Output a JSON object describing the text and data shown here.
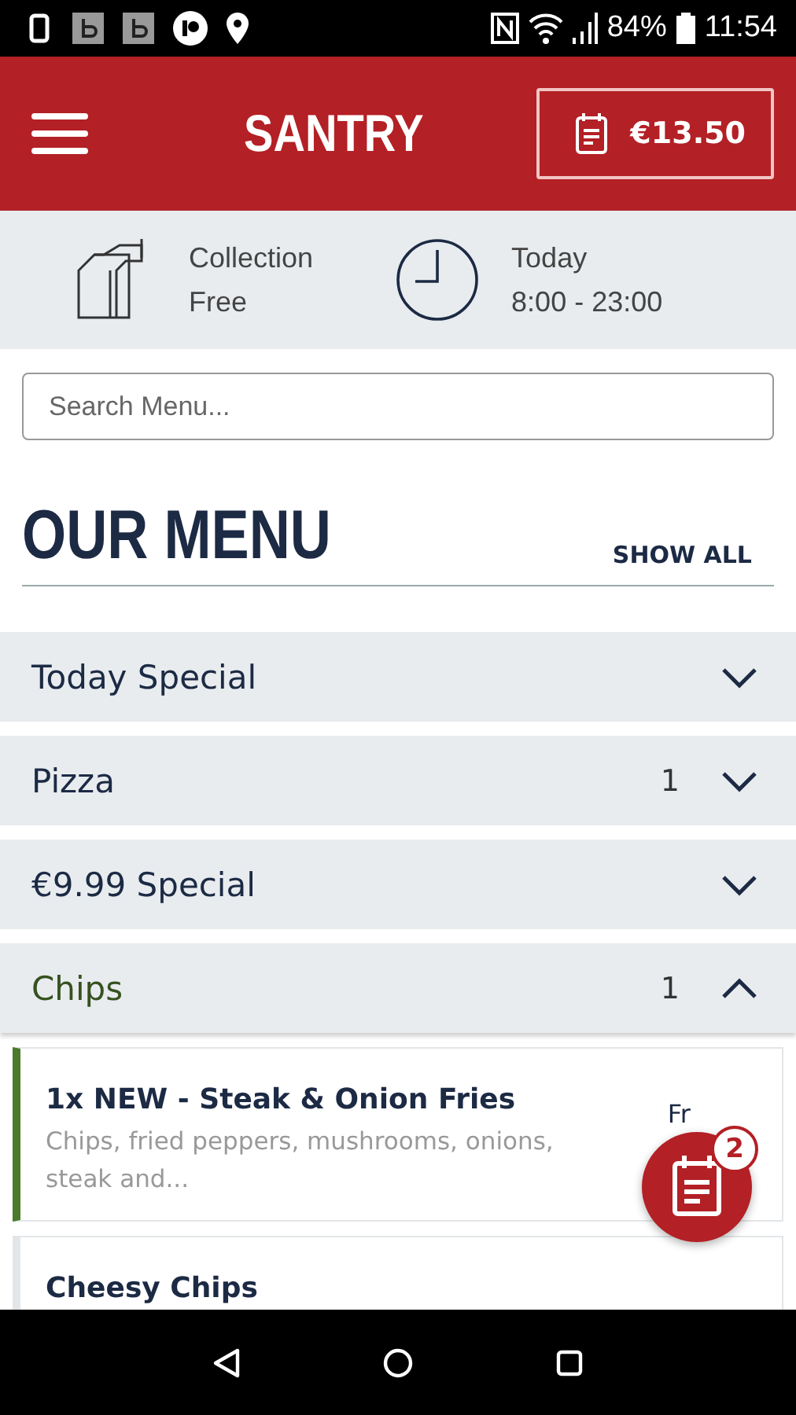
{
  "status_bar": {
    "battery": "84%",
    "time": "11:54"
  },
  "header": {
    "title": "SANTRY",
    "cart_total": "€13.50"
  },
  "info": [
    {
      "kind": "collection",
      "title": "Collection",
      "detail": "Free"
    },
    {
      "kind": "hours",
      "title": "Today",
      "detail": "8:00 - 23:00"
    }
  ],
  "search": {
    "placeholder": "Search Menu..."
  },
  "menu": {
    "title": "OUR MENU",
    "show_all": "SHOW ALL"
  },
  "categories": [
    {
      "name": "Today Special",
      "expanded": false
    },
    {
      "name": "Pizza",
      "count": "1",
      "expanded": false
    },
    {
      "name": "€9.99 Special",
      "expanded": false
    },
    {
      "name": "Chips",
      "count": "1",
      "expanded": true
    }
  ],
  "items": [
    {
      "name": "1x NEW - Steak & Onion Fries",
      "description": "Chips, fried peppers, mushrooms, onions, steak and...",
      "price": "Fr",
      "in_cart": true
    },
    {
      "name": "Cheesy Chips",
      "in_cart": false
    }
  ],
  "cart_fab": {
    "badge": "2"
  }
}
